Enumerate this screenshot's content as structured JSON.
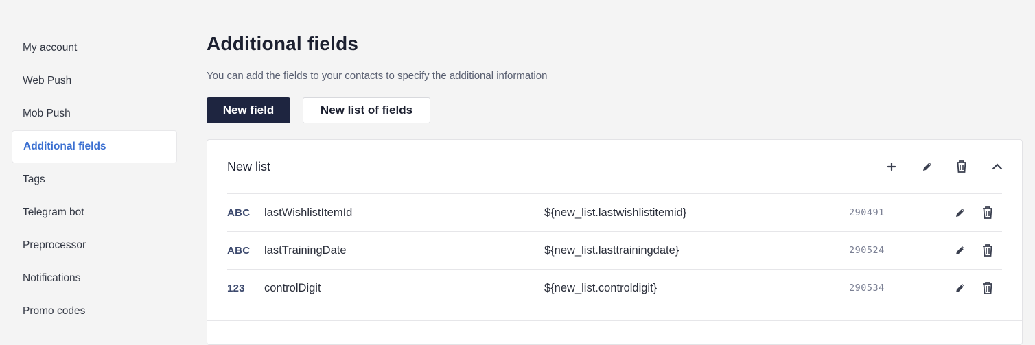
{
  "sidebar": {
    "items": [
      {
        "label": "My account",
        "active": false
      },
      {
        "label": "Web Push",
        "active": false
      },
      {
        "label": "Mob Push",
        "active": false
      },
      {
        "label": "Additional fields",
        "active": true
      },
      {
        "label": "Tags",
        "active": false
      },
      {
        "label": "Telegram bot",
        "active": false
      },
      {
        "label": "Preprocessor",
        "active": false
      },
      {
        "label": "Notifications",
        "active": false
      },
      {
        "label": "Promo codes",
        "active": false
      }
    ]
  },
  "main": {
    "title": "Additional fields",
    "subtitle": "You can add the fields to your contacts to specify the additional information",
    "new_field_label": "New field",
    "new_list_label": "New list of fields"
  },
  "list": {
    "title": "New list",
    "header_icons": [
      "plus-icon",
      "pencil-icon",
      "trash-icon",
      "chevron-up-icon"
    ],
    "rows": [
      {
        "type": "ABC",
        "name": "lastWishlistItemId",
        "variable": "${new_list.lastwishlistitemid}",
        "id": "290491"
      },
      {
        "type": "ABC",
        "name": "lastTrainingDate",
        "variable": "${new_list.lasttrainingdate}",
        "id": "290524"
      },
      {
        "type": "123",
        "name": "controlDigit",
        "variable": "${new_list.controldigit}",
        "id": "290534"
      }
    ]
  },
  "colors": {
    "primary_button": "#1e2540",
    "active_link": "#3a6fd1",
    "background": "#f4f4f4",
    "type_badge": "#3d4a6e"
  }
}
